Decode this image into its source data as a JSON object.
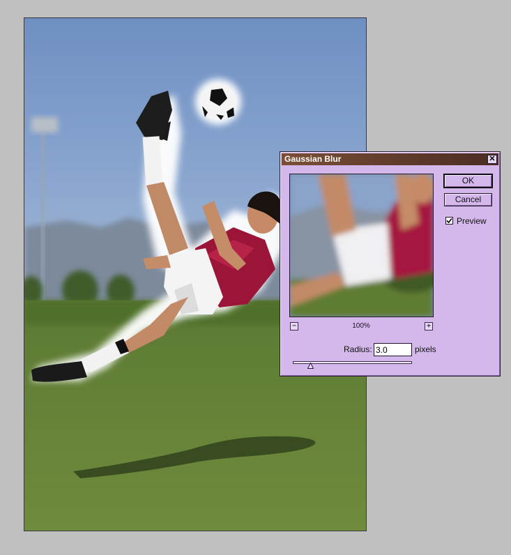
{
  "dialog": {
    "title": "Gaussian Blur",
    "close_symbol": "✕",
    "ok_label": "OK",
    "cancel_label": "Cancel",
    "preview_label": "Preview",
    "preview_checked": true,
    "zoom_out_symbol": "−",
    "zoom_in_symbol": "+",
    "zoom_level": "100%",
    "radius_label": "Radius:",
    "radius_value": "3.0",
    "unit_label": "pixels",
    "slider_fraction": 0.15
  },
  "colors": {
    "dialog_bg": "#d4b8ec",
    "titlebar": "#5d392a",
    "sky": "#7e9cc6",
    "grass": "#6f8a3a",
    "jersey": "#a01a3c"
  },
  "icons": {
    "close": "close-icon",
    "check": "checkmark-icon",
    "slider": "slider-triangle-icon"
  }
}
